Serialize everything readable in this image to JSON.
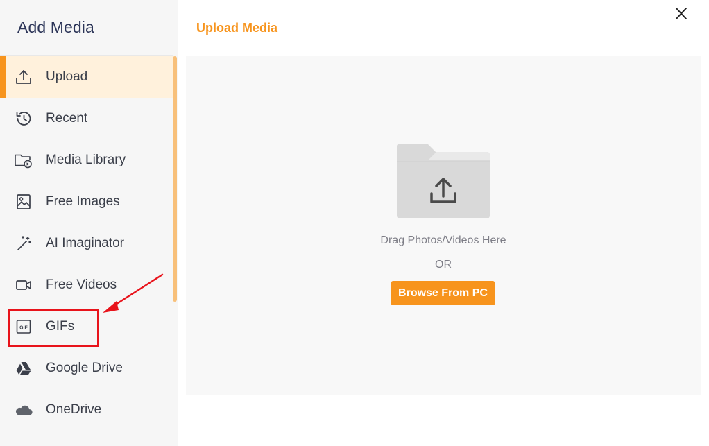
{
  "sidebar": {
    "title": "Add Media",
    "items": [
      {
        "label": "Upload",
        "icon": "upload-icon",
        "active": true
      },
      {
        "label": "Recent",
        "icon": "history-icon"
      },
      {
        "label": "Media Library",
        "icon": "folder-play-icon"
      },
      {
        "label": "Free Images",
        "icon": "image-icon"
      },
      {
        "label": "AI Imaginator",
        "icon": "magic-wand-icon"
      },
      {
        "label": "Free Videos",
        "icon": "video-camera-icon"
      },
      {
        "label": "GIFs",
        "icon": "gif-icon"
      },
      {
        "label": "Google Drive",
        "icon": "google-drive-icon"
      },
      {
        "label": "OneDrive",
        "icon": "onedrive-icon"
      }
    ]
  },
  "main": {
    "title": "Upload Media",
    "drag_text": "Drag Photos/Videos Here",
    "or_text": "OR",
    "browse_label": "Browse From PC"
  },
  "colors": {
    "accent": "#f7941d",
    "active_bg": "#fff1dc",
    "highlight": "#e8131b"
  }
}
